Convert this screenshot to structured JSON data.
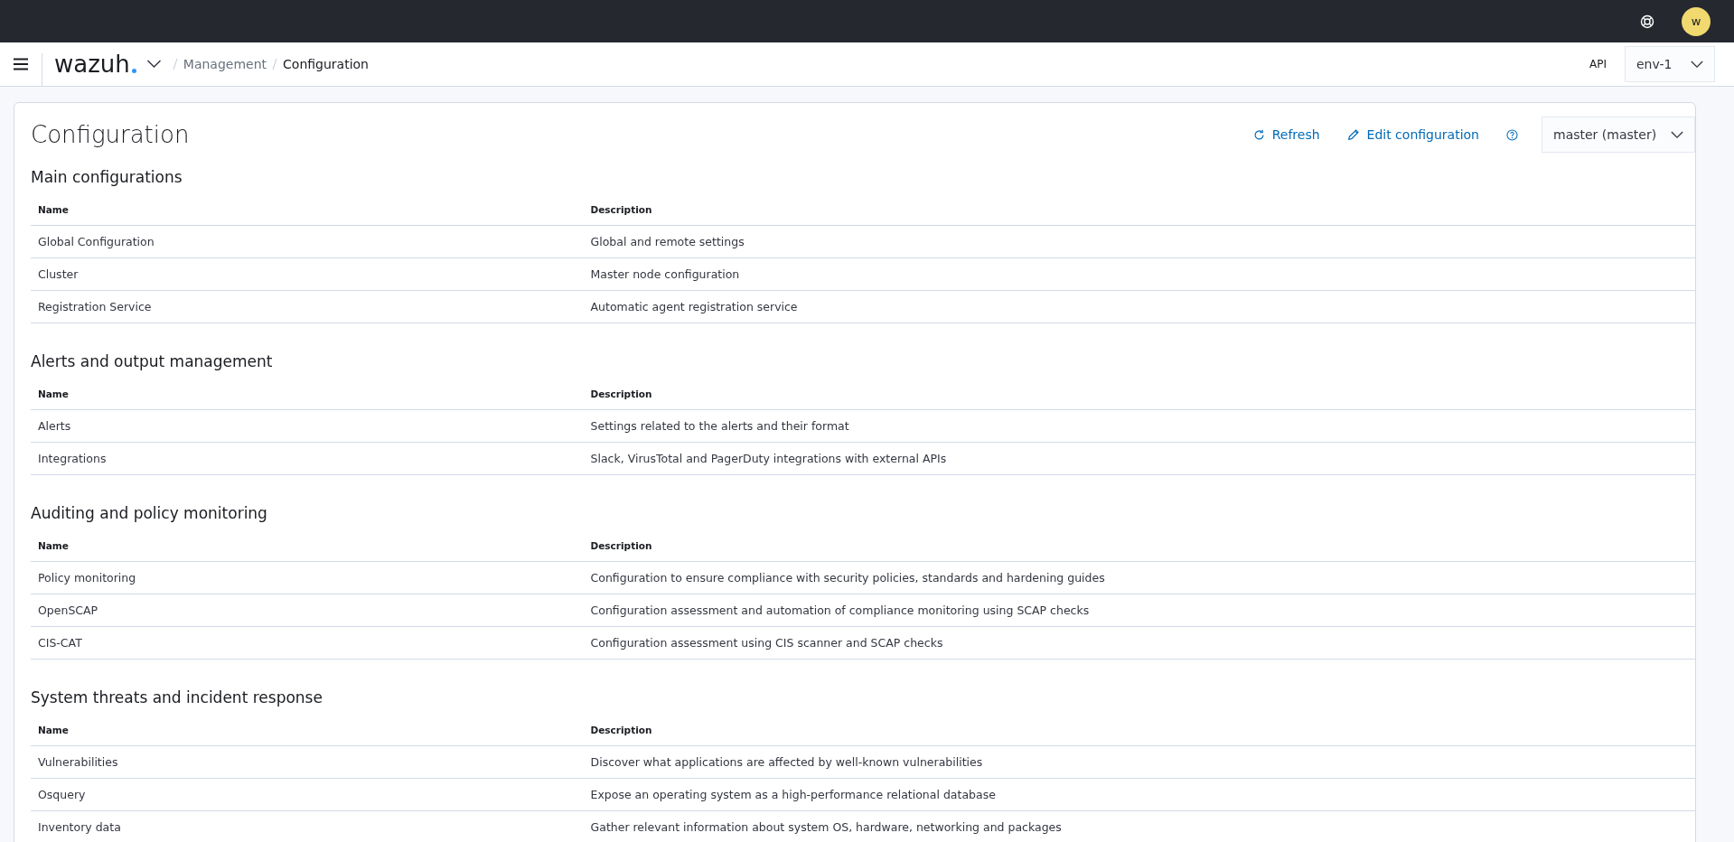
{
  "top_bar": {
    "avatar": "w"
  },
  "header": {
    "logo": "wazuh",
    "breadcrumbs": [
      {
        "label": "Management",
        "current": false
      },
      {
        "label": "Configuration",
        "current": true
      }
    ],
    "api_label": "API",
    "api_select": "env-1"
  },
  "page": {
    "title": "Configuration",
    "actions": [
      {
        "kind": "refresh",
        "label": "Refresh"
      },
      {
        "kind": "edit",
        "label": "Edit configuration"
      },
      {
        "kind": "help"
      }
    ],
    "node_select": "master (master)"
  },
  "sections": [
    {
      "title": "Main configurations",
      "columns": [
        "Name",
        "Description"
      ],
      "rows": [
        [
          "Global Configuration",
          "Global and remote settings"
        ],
        [
          "Cluster",
          "Master node configuration"
        ],
        [
          "Registration Service",
          "Automatic agent registration service"
        ]
      ]
    },
    {
      "title": "Alerts and output management",
      "columns": [
        "Name",
        "Description"
      ],
      "rows": [
        [
          "Alerts",
          "Settings related to the alerts and their format"
        ],
        [
          "Integrations",
          "Slack, VirusTotal and PagerDuty integrations with external APIs"
        ]
      ]
    },
    {
      "title": "Auditing and policy monitoring",
      "columns": [
        "Name",
        "Description"
      ],
      "rows": [
        [
          "Policy monitoring",
          "Configuration to ensure compliance with security policies, standards and hardening guides"
        ],
        [
          "OpenSCAP",
          "Configuration assessment and automation of compliance monitoring using SCAP checks"
        ],
        [
          "CIS-CAT",
          "Configuration assessment using CIS scanner and SCAP checks"
        ]
      ]
    },
    {
      "title": "System threats and incident response",
      "columns": [
        "Name",
        "Description"
      ],
      "rows": [
        [
          "Vulnerabilities",
          "Discover what applications are affected by well-known vulnerabilities"
        ],
        [
          "Osquery",
          "Expose an operating system as a high-performance relational database"
        ],
        [
          "Inventory data",
          "Gather relevant information about system OS, hardware, networking and packages"
        ]
      ]
    }
  ]
}
